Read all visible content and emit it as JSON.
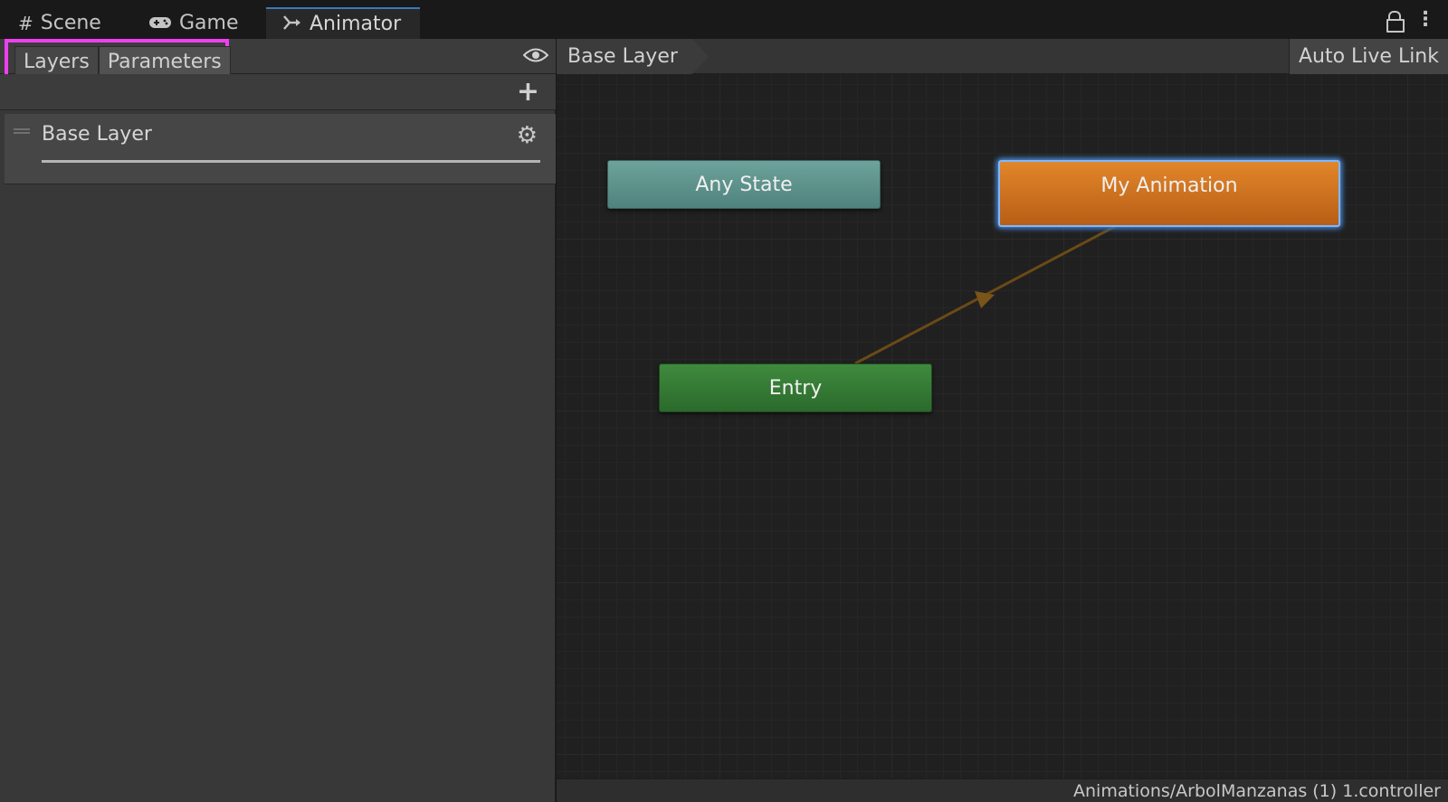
{
  "tabs": [
    {
      "label": "Scene",
      "icon": "grid-icon"
    },
    {
      "label": "Game",
      "icon": "gamepad-icon"
    },
    {
      "label": "Animator",
      "icon": "animator-icon",
      "active": true
    }
  ],
  "left_panel": {
    "segments": [
      "Layers",
      "Parameters"
    ],
    "layers": [
      {
        "name": "Base Layer"
      }
    ]
  },
  "graph": {
    "breadcrumb": "Base Layer",
    "auto_live_link": "Auto Live Link",
    "nodes": {
      "any_state": "Any State",
      "entry": "Entry",
      "my_animation": "My Animation"
    },
    "status_path": "Animations/ArbolManzanas (1) 1.controller"
  },
  "colors": {
    "highlight": "#ee3ff0",
    "any_state": "#5f948e",
    "entry": "#357b35",
    "default_state": "#d27424",
    "selection": "#4f8fe0",
    "transition": "#6b4a16"
  }
}
